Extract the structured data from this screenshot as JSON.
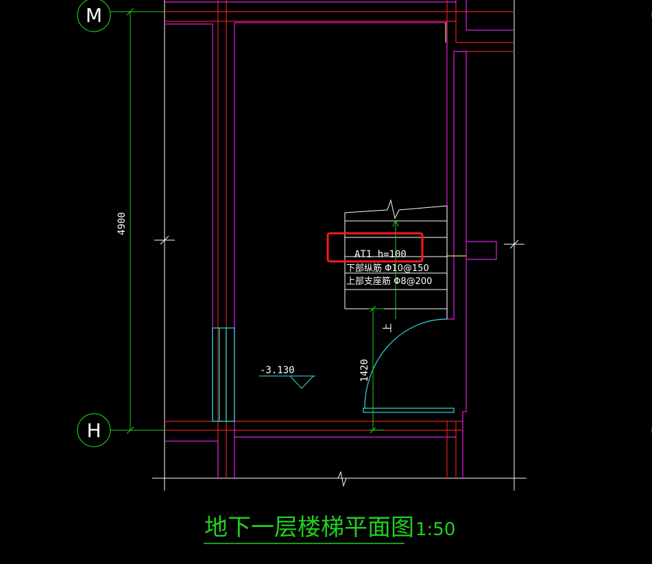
{
  "grid_labels": {
    "top": "M",
    "bottom": "H"
  },
  "dimensions": {
    "overall": "4900",
    "stair_offset": "1420"
  },
  "level_mark": "-3.130",
  "stair": {
    "label": "AT1 h=100",
    "rebar_bottom": "下部纵筋 Φ10@150",
    "rebar_top": "上部支座筋 Φ8@200",
    "direction": "上"
  },
  "drawing_title": "地下一层楼梯平面图",
  "scale": "1:50",
  "colors": {
    "background": "#000000",
    "wall_magenta": "#e020e0",
    "red_line": "#e02020",
    "dim_green": "#20d020",
    "cyan": "#30e0e0",
    "white": "#ffffff",
    "yellow": "#e8e840",
    "highlight_red": "#ff1a1a",
    "axis_circle": "#20c020"
  }
}
